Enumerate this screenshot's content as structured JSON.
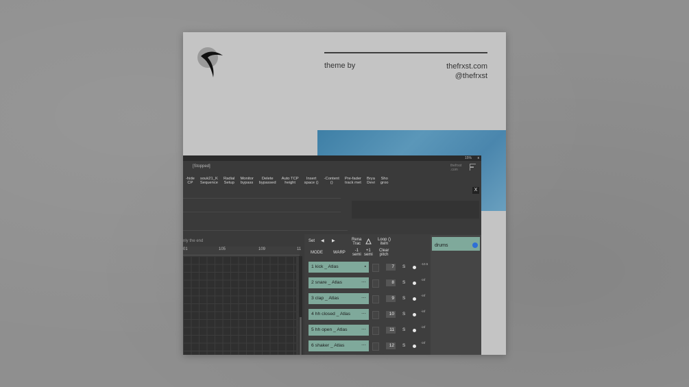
{
  "header": {
    "theme_by": "theme by",
    "site": "thefrxst.com",
    "handle": "@thefrxst"
  },
  "app": {
    "titlebar_text": "15%",
    "titlebar_close": "x",
    "status": "[Stopped]",
    "brand": "thefrxst",
    "brand_sub": ".com",
    "close_panel": "X",
    "toolbar": [
      {
        "label": "-hide\nCP"
      },
      {
        "label": "souk21_K\nSequence"
      },
      {
        "label": "Radial\nSetup"
      },
      {
        "label": "Monitor\nbypass"
      },
      {
        "label": "Delete\nbypassed"
      },
      {
        "label": "Auto TCP\nheight"
      },
      {
        "label": "Insert\nspace ()"
      },
      {
        "label": "-Content\n()"
      },
      {
        "label": "Pre-fader\ntrack met"
      },
      {
        "label": "Brya\nDevi"
      },
      {
        "label": "Sho\ngroo"
      }
    ],
    "hint_text": "nly the end",
    "ruler": [
      "01",
      "105",
      "109",
      "11"
    ],
    "mixer": {
      "set": "Set",
      "prev": "◀",
      "next": "▶",
      "rename": "Rena\nTrac",
      "loop": "Loop ()\nitem",
      "mode": "MODE",
      "warp": "WARP",
      "minus_semi": "-1\nsemi",
      "plus_semi": "+1\nsemi",
      "clear_pitch": "Clear\npitch",
      "tracks": [
        {
          "name": "1 kick _ Atlas",
          "num": "7",
          "solo": "S",
          "level": "-10.5"
        },
        {
          "name": "2 snare _ Atlas",
          "num": "8",
          "solo": "S",
          "level": "-inf"
        },
        {
          "name": "3 clap _ Atlas",
          "num": "9",
          "solo": "S",
          "level": "-inf"
        },
        {
          "name": "4 hh closed _ Atlas",
          "num": "10",
          "solo": "S",
          "level": "-inf"
        },
        {
          "name": "5 hh open _ Atlas",
          "num": "11",
          "solo": "S",
          "level": "-inf"
        },
        {
          "name": "6 shaker _ Atlas",
          "num": "12",
          "solo": "S",
          "level": "-inf"
        }
      ],
      "folder": "drums"
    }
  },
  "colors": {
    "background": "#8f8f8f",
    "card": "#c4c4c4",
    "track_green": "#7fa99b",
    "blue_block": "#4a86ad"
  }
}
